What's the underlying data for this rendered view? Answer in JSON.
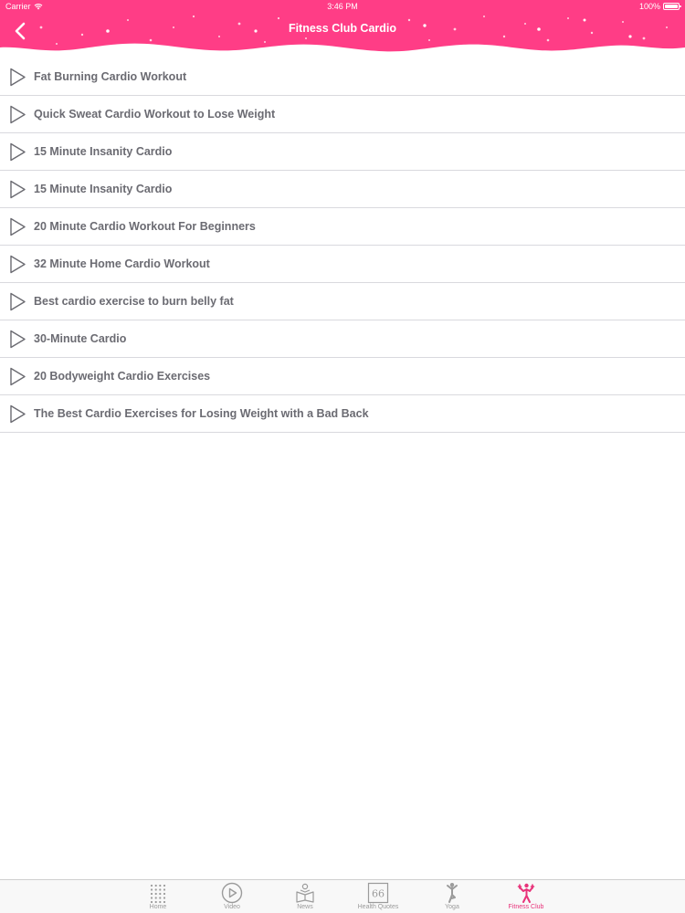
{
  "status_bar": {
    "carrier": "Carrier",
    "time": "3:46 PM",
    "battery": "100%"
  },
  "nav": {
    "title": "Fitness Club Cardio",
    "back_icon": "chevron-left-icon"
  },
  "colors": {
    "header_pink": "#ff3d86",
    "text": "#6b6b72",
    "active_tab": "#e8337a",
    "inactive_tab": "#9b9b9b"
  },
  "items": [
    {
      "title": "Fat Burning Cardio Workout"
    },
    {
      "title": "Quick Sweat Cardio Workout to Lose Weight"
    },
    {
      "title": "15 Minute Insanity Cardio"
    },
    {
      "title": "15 Minute Insanity Cardio"
    },
    {
      "title": "20 Minute Cardio Workout For Beginners"
    },
    {
      "title": "32 Minute Home Cardio Workout"
    },
    {
      "title": "Best cardio exercise to burn belly fat"
    },
    {
      "title": "30-Minute Cardio"
    },
    {
      "title": "20 Bodyweight Cardio Exercises"
    },
    {
      "title": "The Best Cardio Exercises for Losing Weight with a Bad Back"
    }
  ],
  "tabs": [
    {
      "label": "Home",
      "icon": "grid-dots-icon",
      "active": false
    },
    {
      "label": "Video",
      "icon": "play-circle-icon",
      "active": false
    },
    {
      "label": "News",
      "icon": "news-icon",
      "active": false
    },
    {
      "label": "Health Quotes",
      "icon": "quote-icon",
      "active": false
    },
    {
      "label": "Yoga",
      "icon": "yoga-icon",
      "active": false
    },
    {
      "label": "Fitness Club",
      "icon": "fitness-icon",
      "active": true
    }
  ]
}
